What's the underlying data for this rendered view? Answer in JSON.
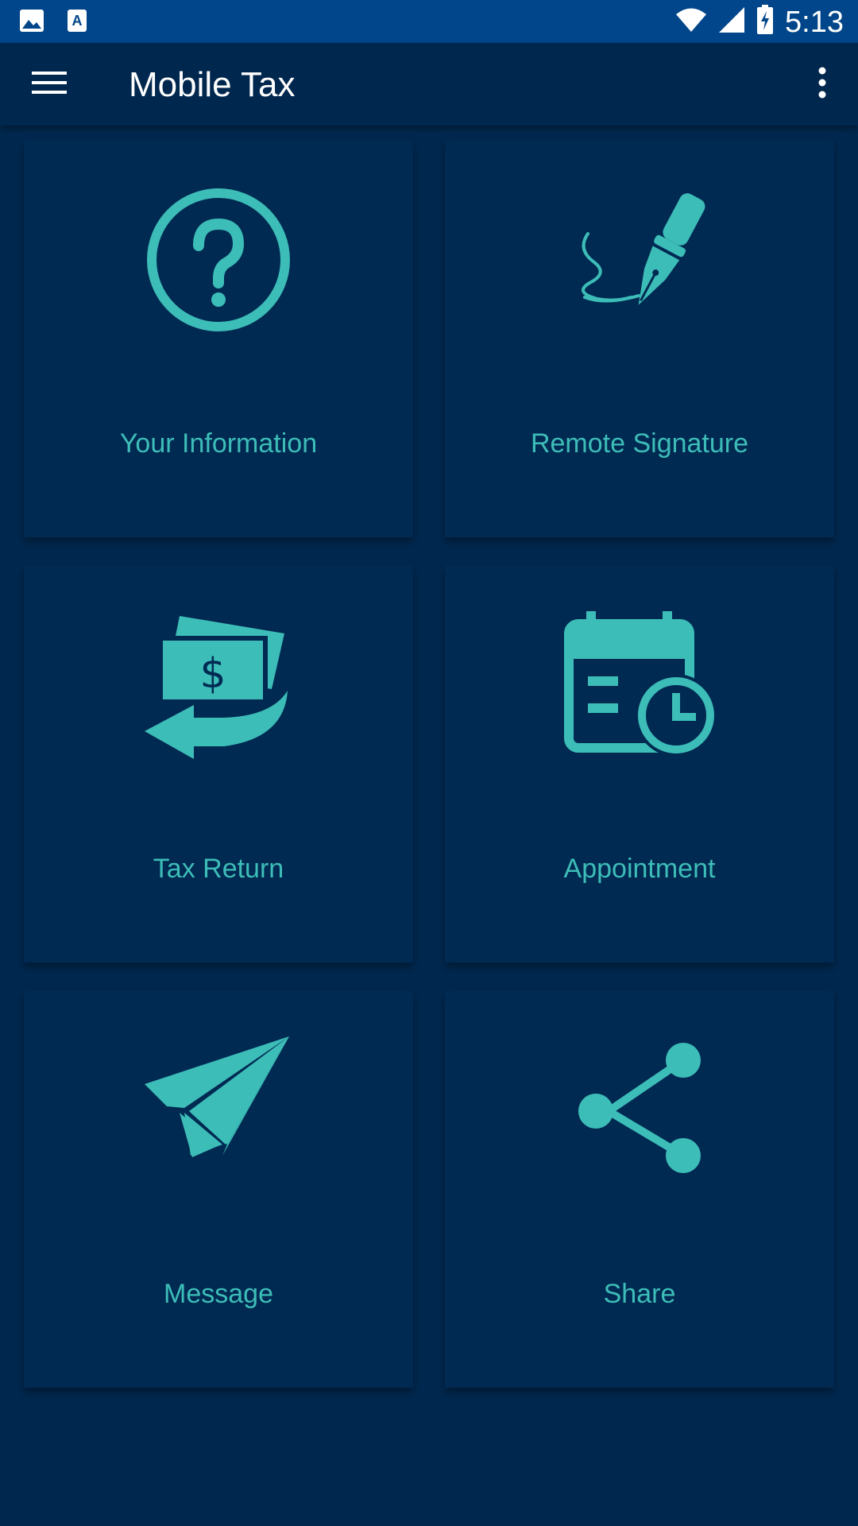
{
  "status_bar": {
    "time": "5:13",
    "icons": [
      "image-icon",
      "text-a-icon",
      "wifi-icon",
      "signal-icon",
      "battery-charging-icon"
    ]
  },
  "app_bar": {
    "title": "Mobile Tax",
    "menu_icon": "hamburger-menu-icon",
    "overflow_icon": "more-vert-icon"
  },
  "colors": {
    "status_bar_bg": "#01468a",
    "app_bar_bg": "#00274e",
    "background": "#00284f",
    "accent": "#3dbdb8"
  },
  "tiles": [
    {
      "label": "Your Information",
      "icon": "help-icon"
    },
    {
      "label": "Remote Signature",
      "icon": "fountain-pen-icon"
    },
    {
      "label": "Tax Return",
      "icon": "money-transfer-icon"
    },
    {
      "label": "Appointment",
      "icon": "calendar-clock-icon"
    },
    {
      "label": "Message",
      "icon": "paper-plane-icon"
    },
    {
      "label": "Share",
      "icon": "share-icon"
    }
  ]
}
